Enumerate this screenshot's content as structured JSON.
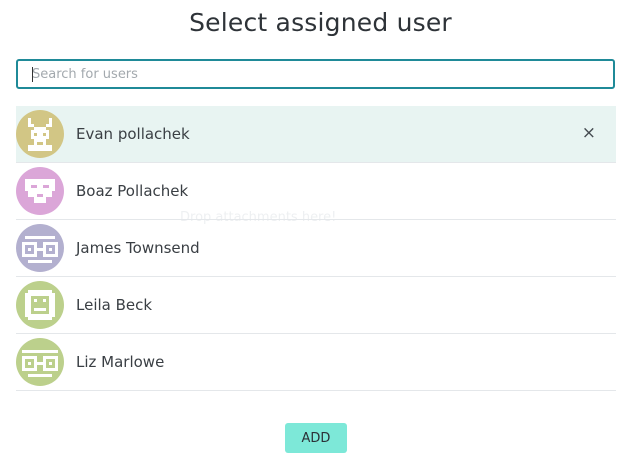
{
  "dialog": {
    "title": "Select assigned user",
    "drop_hint": "Drop attachments here!"
  },
  "search": {
    "placeholder": "Search for users",
    "value": ""
  },
  "users": [
    {
      "name": "Evan pollachek",
      "selected": true,
      "avatar_color": "#d2c685",
      "avatar_icon": "deer-pixel-avatar"
    },
    {
      "name": "Boaz Pollachek",
      "selected": false,
      "avatar_color": "#dba6d8",
      "avatar_icon": "face-pixel-avatar"
    },
    {
      "name": "James Townsend",
      "selected": false,
      "avatar_color": "#b3b0cf",
      "avatar_icon": "owl-pixel-avatar"
    },
    {
      "name": "Leila Beck",
      "selected": false,
      "avatar_color": "#bcd08c",
      "avatar_icon": "face-pixel-avatar"
    },
    {
      "name": "Liz Marlowe",
      "selected": false,
      "avatar_color": "#bcd08c",
      "avatar_icon": "owl-pixel-avatar"
    }
  ],
  "remove_label": "×",
  "add_label": "ADD",
  "colors": {
    "accent": "#1f8a98",
    "selected_row": "#e8f4f2",
    "add_button": "#7de8d8"
  }
}
